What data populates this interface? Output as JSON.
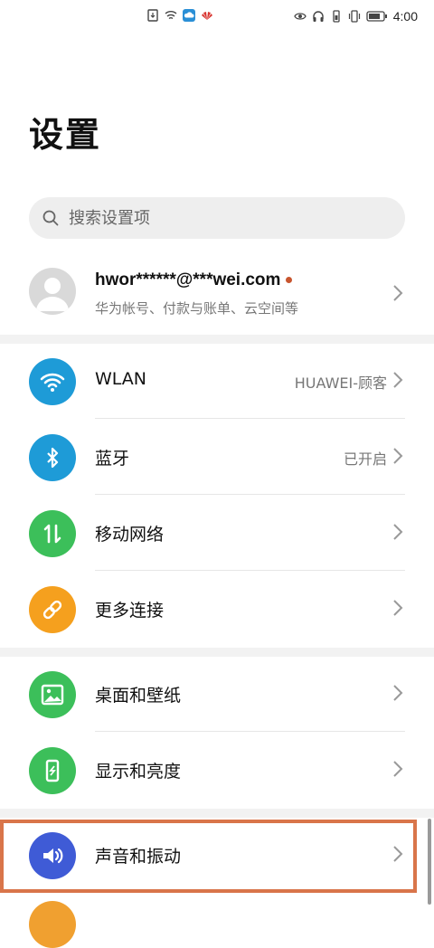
{
  "status_bar": {
    "time": "4:00"
  },
  "header": {
    "title": "设置"
  },
  "search": {
    "placeholder": "搜索设置项"
  },
  "account": {
    "name": "hwor******@***wei.com",
    "subtitle": "华为帐号、付款与账单、云空间等"
  },
  "colors": {
    "wlan": "#1e9bd7",
    "bluetooth": "#1e9bd7",
    "mobile": "#3cbf5a",
    "more": "#f5a01e",
    "wallpaper": "#3cbf5a",
    "display": "#3cbf5a",
    "sound": "#3f5bd6",
    "highlight": "#d9754a"
  },
  "groups": [
    {
      "items": [
        {
          "label": "WLAN",
          "value": "HUAWEI-顾客",
          "icon": "wifi-icon"
        },
        {
          "label": "蓝牙",
          "value": "已开启",
          "icon": "bluetooth-icon"
        },
        {
          "label": "移动网络",
          "value": "",
          "icon": "mobile-data-icon"
        },
        {
          "label": "更多连接",
          "value": "",
          "icon": "link-icon"
        }
      ]
    },
    {
      "items": [
        {
          "label": "桌面和壁纸",
          "value": "",
          "icon": "image-icon"
        },
        {
          "label": "显示和亮度",
          "value": "",
          "icon": "phone-display-icon"
        }
      ]
    },
    {
      "items": [
        {
          "label": "声音和振动",
          "value": "",
          "icon": "speaker-icon"
        }
      ]
    }
  ]
}
